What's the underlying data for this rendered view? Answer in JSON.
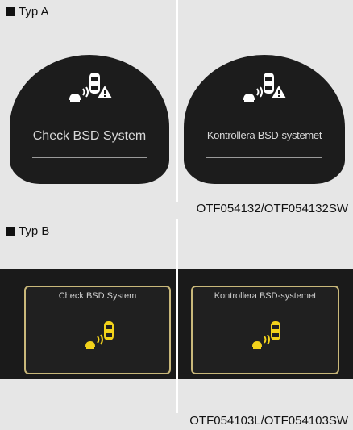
{
  "section_a": {
    "heading": "Typ A",
    "left_display": {
      "message": "Check BSD System"
    },
    "right_display": {
      "message": "Kontrollera BSD-systemet"
    },
    "image_code": "OTF054132/OTF054132SW"
  },
  "section_b": {
    "heading": "Typ B",
    "left_display": {
      "message": "Check BSD System"
    },
    "right_display": {
      "message": "Kontrollera BSD-systemet"
    },
    "image_code": "OTF054103L/OTF054103SW"
  },
  "colors": {
    "display_bg": "#1c1c1c",
    "icon_white": "#ffffff",
    "icon_yellow": "#f2d21b",
    "panel_border": "#c9b87a"
  },
  "icons": [
    "bsd-warning-icon",
    "bsd-yellow-icon"
  ]
}
